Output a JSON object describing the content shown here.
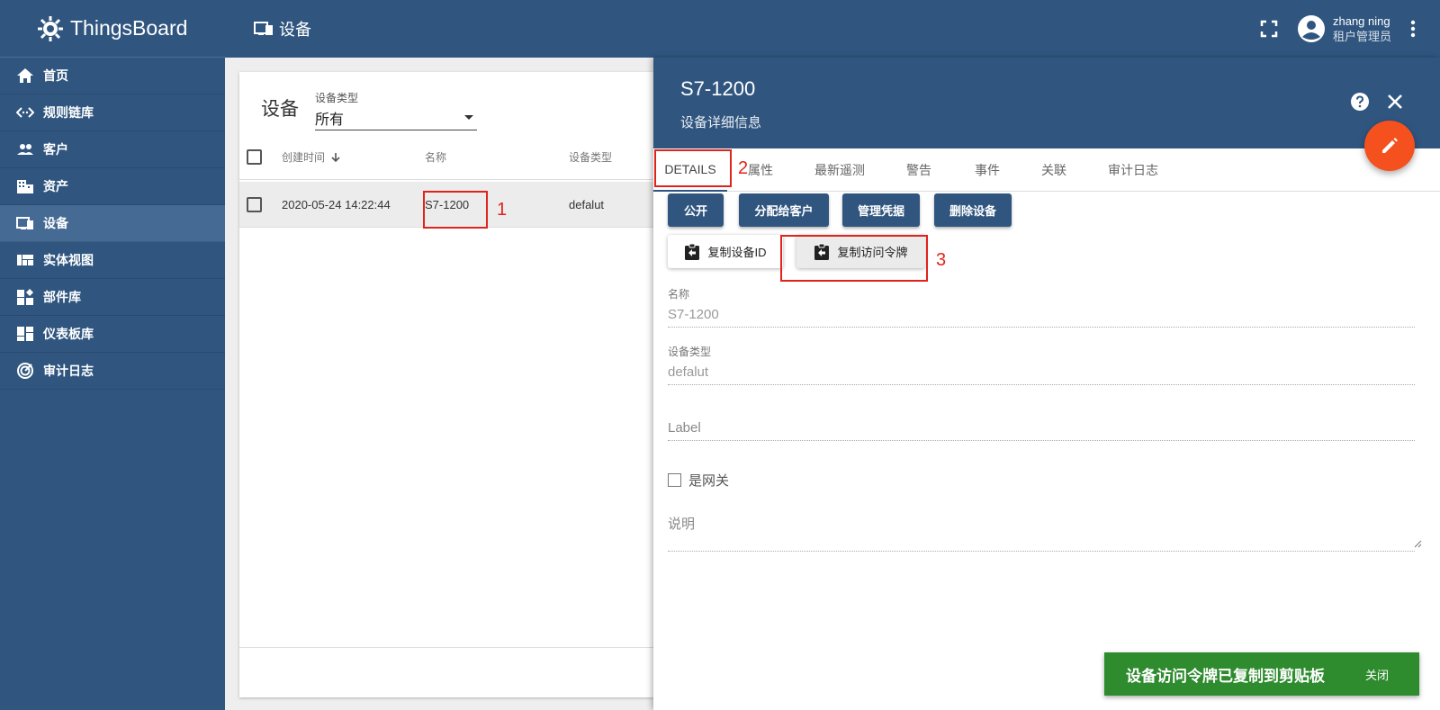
{
  "app": {
    "name": "ThingsBoard"
  },
  "sidebar": {
    "items": [
      {
        "label": "首页",
        "icon": "home-icon"
      },
      {
        "label": "规则链库",
        "icon": "code-arrows-icon"
      },
      {
        "label": "客户",
        "icon": "people-icon"
      },
      {
        "label": "资产",
        "icon": "building-icon"
      },
      {
        "label": "设备",
        "icon": "devices-icon"
      },
      {
        "label": "实体视图",
        "icon": "view-quilt-icon"
      },
      {
        "label": "部件库",
        "icon": "widgets-icon"
      },
      {
        "label": "仪表板库",
        "icon": "dashboard-icon"
      },
      {
        "label": "审计日志",
        "icon": "track-changes-icon"
      }
    ],
    "active_index": 4
  },
  "topbar": {
    "title": "设备",
    "user_name": "zhang ning",
    "user_role": "租户管理员"
  },
  "device_list": {
    "title": "设备",
    "type_filter_label": "设备类型",
    "type_filter_value": "所有",
    "columns": [
      "创建时间",
      "名称",
      "设备类型"
    ],
    "rows": [
      {
        "created": "2020-05-24 14:22:44",
        "name": "S7-1200",
        "type": "defalut"
      }
    ]
  },
  "detail": {
    "title": "S7-1200",
    "subtitle": "设备详细信息",
    "tabs": [
      "DETAILS",
      "属性",
      "最新遥测",
      "警告",
      "事件",
      "关联",
      "审计日志"
    ],
    "active_tab": 0,
    "actions": [
      "公开",
      "分配给客户",
      "管理凭据",
      "删除设备"
    ],
    "copy_id_label": "复制设备ID",
    "copy_token_label": "复制访问令牌",
    "fields": {
      "name_label": "名称",
      "name_value": "S7-1200",
      "type_label": "设备类型",
      "type_value": "defalut",
      "label_placeholder": "Label",
      "gateway_label": "是网关",
      "description_placeholder": "说明"
    }
  },
  "snackbar": {
    "message": "设备访问令牌已复制到剪贴板",
    "close_label": "关闭"
  },
  "annotations": [
    "1",
    "2",
    "3"
  ],
  "colors": {
    "primary": "#305680",
    "accent": "#f4511e",
    "snackbar": "#2e8b2e",
    "annotation": "#e0241b"
  }
}
